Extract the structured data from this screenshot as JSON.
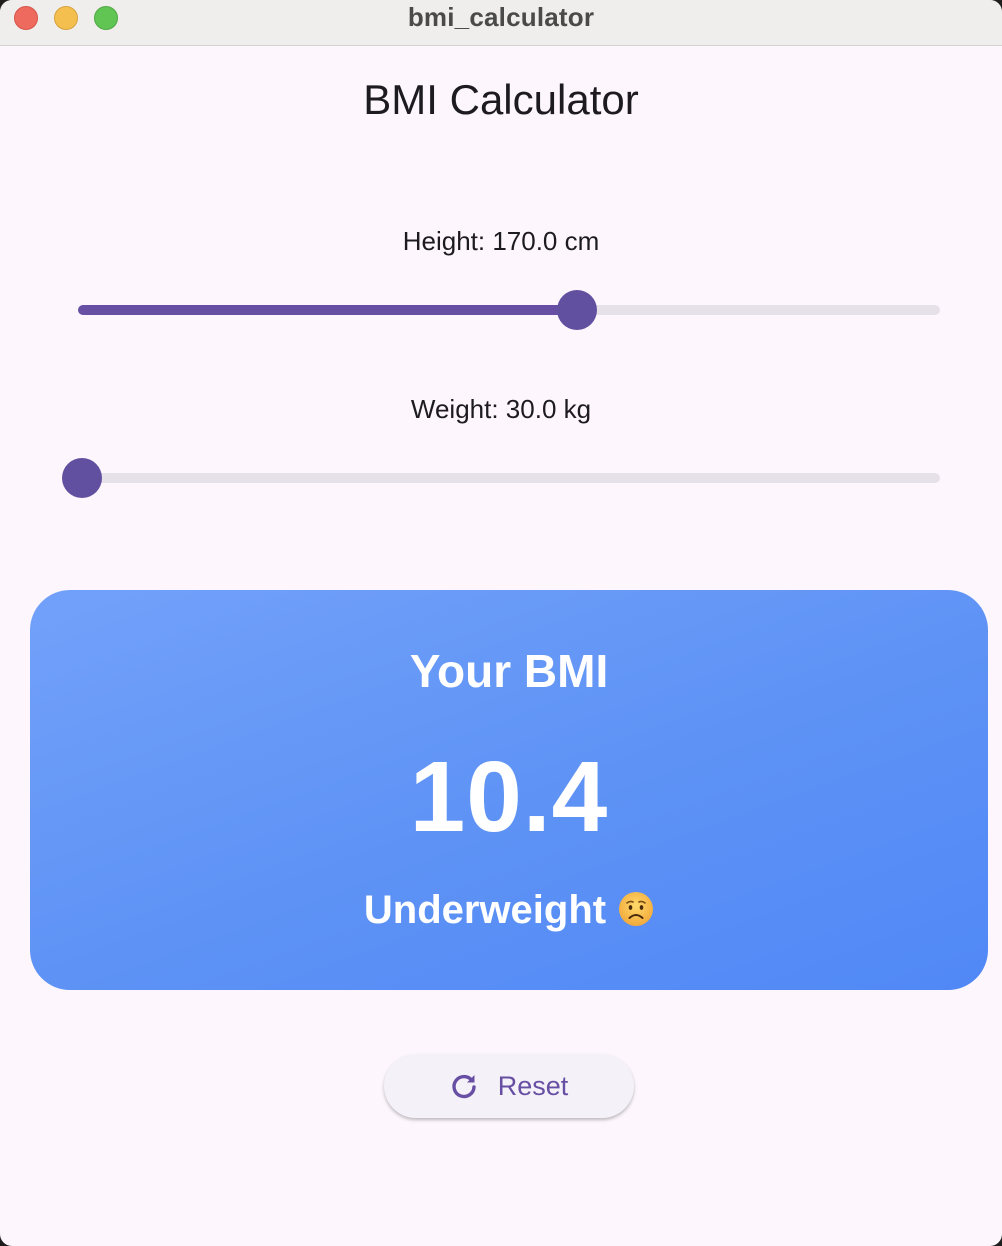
{
  "window": {
    "title": "bmi_calculator"
  },
  "app": {
    "title": "BMI Calculator"
  },
  "height_slider": {
    "label": "Height: 170.0 cm",
    "fraction": 0.58
  },
  "weight_slider": {
    "label": "Weight: 30.0 kg",
    "fraction": 0.0
  },
  "result": {
    "heading": "Your BMI",
    "value": "10.4",
    "category": "Underweight",
    "emoji_icon": "worried-face-icon"
  },
  "reset": {
    "label": "Reset",
    "icon": "refresh-icon"
  },
  "colors": {
    "accent": "#6750a4",
    "card_start": "#72a1fa",
    "card_end": "#5088f6",
    "background": "#fdf7fd"
  }
}
